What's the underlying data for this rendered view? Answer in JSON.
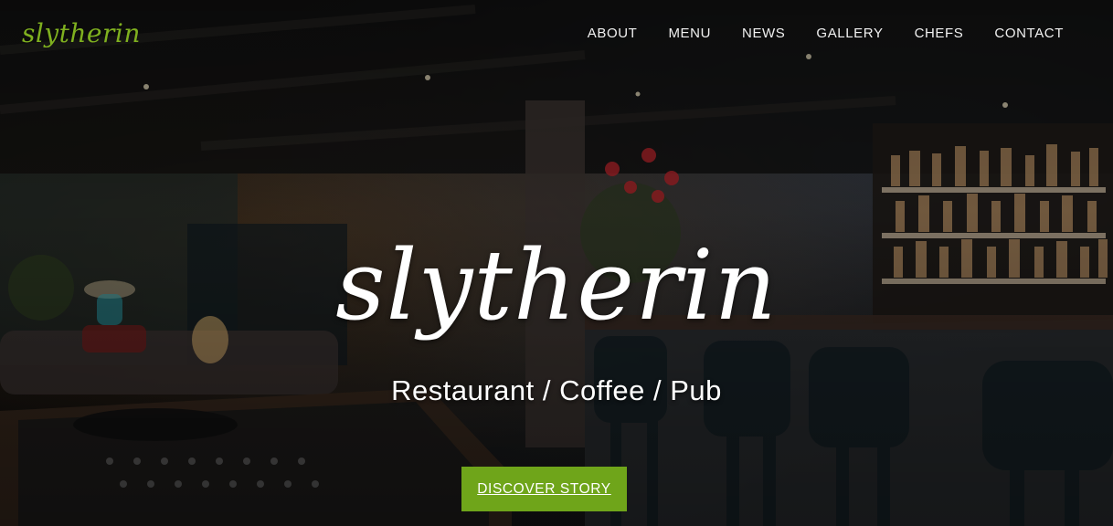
{
  "header": {
    "logo_text": "slytherin",
    "nav": [
      "ABOUT",
      "MENU",
      "NEWS",
      "GALLERY",
      "CHEFS",
      "CONTACT"
    ]
  },
  "hero": {
    "title": "slytherin",
    "subtitle": "Restaurant / Coffee / Pub",
    "cta_label": "DISCOVER STORY"
  },
  "colors": {
    "accent": "#6fa51a",
    "logo": "#7fb01f",
    "text": "#ffffff"
  }
}
